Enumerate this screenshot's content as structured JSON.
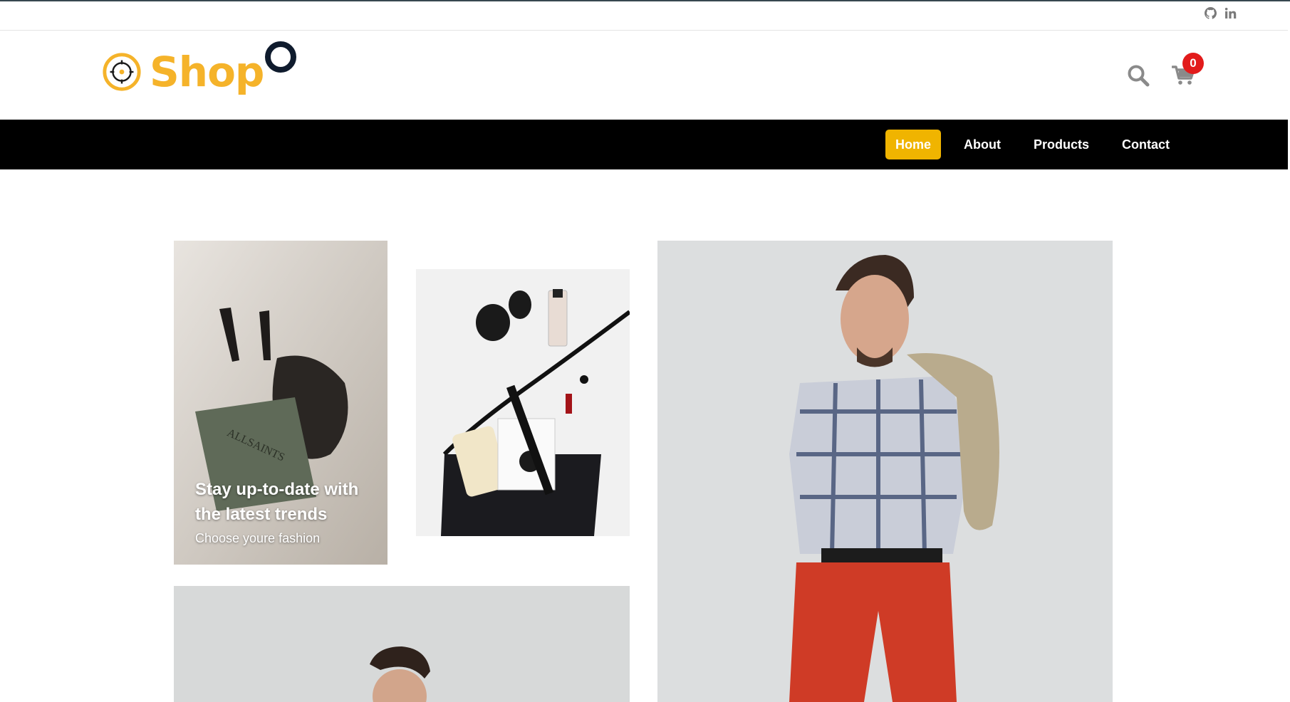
{
  "topbar": {
    "social": [
      {
        "icon": "github-icon"
      },
      {
        "icon": "linkedin-icon"
      }
    ]
  },
  "header": {
    "logo_text": "Shop",
    "cart_count": "0",
    "brand_color": "#f5b32a"
  },
  "nav": {
    "items": [
      {
        "label": "Home",
        "active": true
      },
      {
        "label": "About",
        "active": false
      },
      {
        "label": "Products",
        "active": false
      },
      {
        "label": "Contact",
        "active": false
      }
    ],
    "active_color": "#f0b400"
  },
  "hero": {
    "title": "Stay up-to-date with the latest trends",
    "subtitle": "Choose youre fashion"
  },
  "colors": {
    "nav_bg": "#000000",
    "badge": "#e21b1b",
    "icon_gray": "#8a8a8a"
  }
}
